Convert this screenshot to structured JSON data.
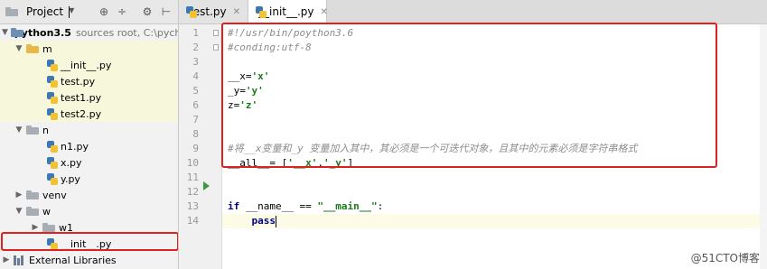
{
  "project_panel": {
    "title": "Project",
    "icons": [
      "target-icon",
      "collapse-icon",
      "gear-icon",
      "hide-icon"
    ],
    "tree": {
      "root": {
        "label": "python3.5",
        "hint": "sources root,  C:\\pych"
      },
      "items": [
        {
          "label": "m"
        },
        {
          "label": "__init__.py"
        },
        {
          "label": "test.py"
        },
        {
          "label": "test1.py"
        },
        {
          "label": "test2.py"
        },
        {
          "label": "n"
        },
        {
          "label": "n1.py"
        },
        {
          "label": "x.py"
        },
        {
          "label": "y.py"
        },
        {
          "label": "venv"
        },
        {
          "label": "w"
        },
        {
          "label": "w1"
        },
        {
          "label": "__init__.py"
        },
        {
          "label": "External Libraries"
        }
      ]
    }
  },
  "editor": {
    "tabs": [
      {
        "label": "test.py",
        "active": false
      },
      {
        "label": "__init__.py",
        "active": true
      }
    ],
    "line_numbers": [
      "1",
      "2",
      "3",
      "4",
      "5",
      "6",
      "7",
      "8",
      "9",
      "10",
      "11",
      "12",
      "13",
      "14"
    ],
    "code": {
      "l1": "#!/usr/bin/poython3.6",
      "l2": "#conding:utf-8",
      "l4_name": "__x=",
      "l4_val": "'x'",
      "l5_name": "_y=",
      "l5_val": "'y'",
      "l6_name": "z=",
      "l6_val": "'z'",
      "l9": "#将__x变量和_y 变量加入其中，其必须是一个可迭代对象，且其中的元素必须是字符串格式",
      "l10_name": "__all__= [",
      "l10_v1": "'__x'",
      "l10_sep": ",",
      "l10_v2": "'_y'",
      "l10_end": "]",
      "l13_if": "if",
      "l13_name": " __name__ == ",
      "l13_main": "\"__main__\"",
      "l13_colon": ":",
      "l14_pass": "pass"
    }
  },
  "watermark": "@51CTO博客",
  "colors": {
    "highlight_box": "#e02020",
    "run_arrow": "#3d9a3d",
    "string": "#1a7a1a",
    "keyword": "#000080",
    "comment": "#8c8c8c"
  }
}
